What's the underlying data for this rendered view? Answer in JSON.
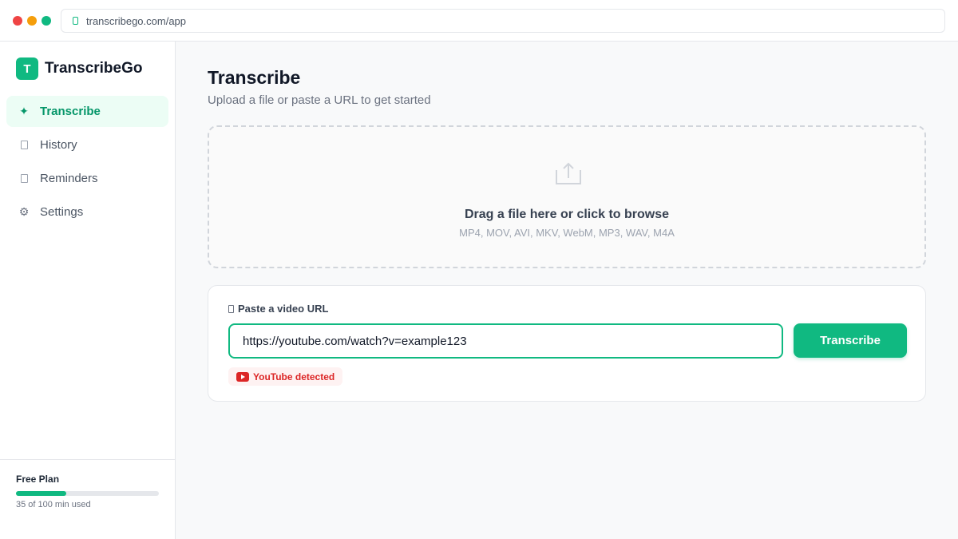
{
  "browser": {
    "url": "transcribego.com/app"
  },
  "brand": {
    "logo_letter": "T",
    "name": "TranscribeGo"
  },
  "sidebar": {
    "items": [
      {
        "label": "Transcribe",
        "icon": "sparkle-icon",
        "active": true
      },
      {
        "label": "History",
        "icon": "document-icon"
      },
      {
        "label": "Reminders",
        "icon": "bell-icon"
      },
      {
        "label": "Settings",
        "icon": "gear-icon"
      }
    ]
  },
  "plan": {
    "name": "Free Plan",
    "usage_text": "35 of 100 min used",
    "used_fraction": 0.35
  },
  "main": {
    "title": "Transcribe",
    "subtitle": "Upload a file or paste a URL to get started"
  },
  "dropzone": {
    "title": "Drag a file here or click to browse",
    "formats": "MP4, MOV, AVI, MKV, WebM, MP3, WAV, M4A"
  },
  "url_section": {
    "label": "Paste a video URL",
    "input_value": "https://youtube.com/watch?v=example123",
    "button_label": "Transcribe",
    "badge": "YouTube detected"
  },
  "colors": {
    "accent": "#10b981",
    "accent_bg": "#ecfdf5",
    "danger": "#dc2626"
  }
}
